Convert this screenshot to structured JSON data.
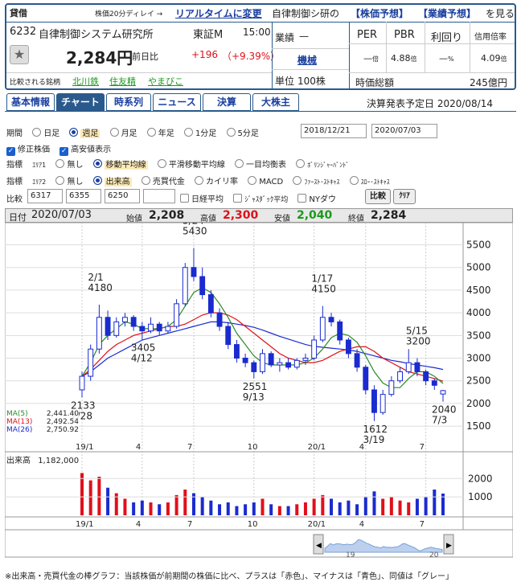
{
  "header": {
    "badge": "貸借",
    "delay_note": "株価20分ディレイ →",
    "realtime_link": "リアルタイムに変更",
    "promo_prefix": "自律制御シ研の",
    "forecast_link": "【株価予想】",
    "earnings_link": "【業績予想】",
    "promo_suffix": "を見る",
    "code": "6232",
    "name": "自律制御システム研究所",
    "market": "東証M",
    "time": "15:00",
    "price": "2,284円",
    "change_label": "前日比",
    "change": "+196",
    "change_pct": "（+9.39%）",
    "compare_label": "比較される銘柄",
    "compare_1": "北川鉄",
    "compare_2": "住友精",
    "compare_3": "やまびこ",
    "perf_label": "業績",
    "perf_value": "—",
    "sector": "機械",
    "unit_label": "単位",
    "unit_value": "100株",
    "per_label": "PER",
    "pbr_label": "PBR",
    "yield_label": "利回り",
    "margin_label": "信用倍率",
    "per_value": "—",
    "per_unit": "倍",
    "pbr_value": "4.88",
    "pbr_unit": "倍",
    "yield_value": "—",
    "yield_unit": "%",
    "margin_value": "4.09",
    "margin_unit": "倍",
    "cap_label": "時価総額",
    "cap_value": "245億円"
  },
  "tabs": [
    "基本情報",
    "チャート",
    "時系列",
    "ニュース",
    "決算",
    "大株主"
  ],
  "earnings_date": "決算発表予定日 2020/08/14",
  "controls": {
    "period_label": "期間",
    "periods": [
      "日足",
      "週足",
      "月足",
      "年足",
      "1分足",
      "5分足"
    ],
    "date_from": "2018/12/21",
    "date_to": "2020/07/03",
    "chk1": "修正株価",
    "chk2": "高安値表示",
    "ind1_label": "指標",
    "ind1_area": "ｴﾘｱ1",
    "ind1_opts": [
      "無し",
      "移動平均線",
      "平滑移動平均線",
      "一目均衡表",
      "ﾎﾞﾘﾝｼﾞｬｰﾊﾞﾝﾄﾞ"
    ],
    "ind2_label": "指標",
    "ind2_area": "ｴﾘｱ2",
    "ind2_opts": [
      "無し",
      "出来高",
      "売買代金",
      "カイリ率",
      "MACD",
      "ﾌｧｰｽﾄ･ｽﾄｷｬｽ",
      "ｽﾛｰ･ｽﾄｷｬｽ"
    ],
    "cmp_label": "比較",
    "cmp_codes": [
      "6317",
      "6355",
      "6250"
    ],
    "cmp_opts": [
      "日経平均",
      "ｼﾞｬｽﾀﾞｯｸ平均",
      "NYダウ"
    ],
    "cmp_btn": "比較",
    "clear_btn": "ｸﾘｱ"
  },
  "ohlc": {
    "date_label": "日付",
    "date": "2020/07/03",
    "open_label": "始値",
    "open": "2,208",
    "high_label": "高値",
    "high": "2,300",
    "low_label": "安値",
    "low": "2,040",
    "close_label": "終値",
    "close": "2,284"
  },
  "ma": {
    "ma5_label": "MA(5)",
    "ma5": "2,441.40",
    "ma13_label": "MA(13)",
    "ma13": "2,492.54",
    "ma26_label": "MA(26)",
    "ma26": "2,750.92"
  },
  "volume": {
    "label": "出来高",
    "value": "1,182,000"
  },
  "footnote": "※出来高・売買代金の棒グラフ：当該株価が前期間の株価に比べ、プラスは「赤色」、マイナスは「青色」、同値は「グレー」",
  "colors": {
    "up": "#e0101a",
    "down": "#1a2bd0",
    "ma5": "#2a8a2a",
    "ma13": "#e0101a",
    "ma26": "#1a2bd0",
    "frame": "#2a5a8c"
  },
  "chart_data": {
    "type": "candlestick",
    "x_tick_labels": [
      "19/1",
      "4",
      "7",
      "10",
      "20/1",
      "4",
      "7"
    ],
    "y_tick_labels": [
      5500,
      5000,
      4500,
      4000,
      3500,
      3000,
      2500,
      2000,
      1500
    ],
    "ylim": [
      1200,
      5900
    ],
    "annotations": [
      {
        "text": "5/24",
        "value": "5430"
      },
      {
        "text": "2/1",
        "value": "4180"
      },
      {
        "text": "1/17",
        "value": "4150"
      },
      {
        "text": "5/15",
        "value": "3200"
      },
      {
        "text": "3405",
        "value": "4/12"
      },
      {
        "text": "2551",
        "value": "9/13"
      },
      {
        "text": "2133",
        "value": "2/28"
      },
      {
        "text": "1612",
        "value": "3/19"
      },
      {
        "text": "2040",
        "value": "7/3"
      }
    ],
    "candles": [
      [
        2300,
        2700,
        2133,
        2600
      ],
      [
        2600,
        3300,
        2500,
        3200
      ],
      [
        3200,
        4180,
        3100,
        3900
      ],
      [
        3900,
        4050,
        3400,
        3500
      ],
      [
        3500,
        3900,
        3450,
        3800
      ],
      [
        3800,
        4000,
        3700,
        3900
      ],
      [
        3900,
        3950,
        3600,
        3700
      ],
      [
        3700,
        3800,
        3405,
        3600
      ],
      [
        3600,
        3900,
        3550,
        3750
      ],
      [
        3750,
        3800,
        3500,
        3600
      ],
      [
        3600,
        3800,
        3550,
        3700
      ],
      [
        3700,
        4300,
        3650,
        4200
      ],
      [
        4200,
        5100,
        4150,
        5000
      ],
      [
        5000,
        5430,
        4700,
        4800
      ],
      [
        4800,
        5000,
        4300,
        4400
      ],
      [
        4400,
        4500,
        3900,
        4000
      ],
      [
        4000,
        4100,
        3600,
        3700
      ],
      [
        3700,
        3800,
        3200,
        3300
      ],
      [
        3300,
        3400,
        2900,
        3000
      ],
      [
        3000,
        3100,
        2800,
        2900
      ],
      [
        2900,
        2950,
        2551,
        2700
      ],
      [
        2700,
        3200,
        2650,
        3100
      ],
      [
        3100,
        3150,
        2800,
        2850
      ],
      [
        2850,
        3000,
        2700,
        2900
      ],
      [
        2900,
        3000,
        2750,
        2800
      ],
      [
        2800,
        3000,
        2750,
        2950
      ],
      [
        2950,
        3100,
        2850,
        3000
      ],
      [
        3000,
        3500,
        2950,
        3400
      ],
      [
        3400,
        4150,
        3350,
        3900
      ],
      [
        3900,
        4000,
        3700,
        3800
      ],
      [
        3800,
        3850,
        3300,
        3400
      ],
      [
        3400,
        3450,
        3000,
        3100
      ],
      [
        3100,
        3200,
        2700,
        2800
      ],
      [
        2800,
        2850,
        2200,
        2300
      ],
      [
        2300,
        2400,
        1612,
        1800
      ],
      [
        1800,
        2300,
        1750,
        2200
      ],
      [
        2200,
        2600,
        2150,
        2500
      ],
      [
        2500,
        2800,
        2450,
        2700
      ],
      [
        2700,
        3200,
        2650,
        2900
      ],
      [
        2900,
        3000,
        2600,
        2700
      ],
      [
        2700,
        2750,
        2400,
        2500
      ],
      [
        2500,
        2550,
        2300,
        2400
      ],
      [
        2208,
        2300,
        2040,
        2284
      ]
    ],
    "ma5": [
      2600,
      2900,
      3300,
      3500,
      3650,
      3800,
      3750,
      3650,
      3650,
      3650,
      3700,
      3850,
      4150,
      4450,
      4550,
      4450,
      4200,
      3900,
      3550,
      3300,
      3050,
      2900,
      2850,
      2850,
      2850,
      2850,
      2900,
      3000,
      3200,
      3450,
      3550,
      3500,
      3350,
      3050,
      2700,
      2450,
      2350,
      2350,
      2550,
      2700,
      2700,
      2600,
      2441
    ],
    "ma13": [
      2600,
      2750,
      2950,
      3150,
      3300,
      3400,
      3500,
      3550,
      3600,
      3650,
      3700,
      3700,
      3750,
      3850,
      3950,
      4000,
      4000,
      3950,
      3850,
      3700,
      3550,
      3400,
      3250,
      3100,
      3000,
      2950,
      2900,
      2900,
      2950,
      3050,
      3150,
      3200,
      3250,
      3250,
      3150,
      3000,
      2900,
      2800,
      2700,
      2650,
      2600,
      2550,
      2492
    ],
    "ma26": [
      2600,
      2700,
      2850,
      3000,
      3100,
      3200,
      3300,
      3400,
      3450,
      3500,
      3550,
      3600,
      3650,
      3700,
      3750,
      3800,
      3800,
      3780,
      3750,
      3720,
      3680,
      3620,
      3550,
      3480,
      3420,
      3360,
      3300,
      3260,
      3240,
      3220,
      3200,
      3180,
      3150,
      3100,
      3050,
      3000,
      2950,
      2920,
      2880,
      2850,
      2820,
      2790,
      2751
    ],
    "volume_ylim": [
      0,
      2800
    ],
    "volume_ticks": [
      2000,
      1000
    ],
    "volume_values": [
      2300,
      1900,
      2100,
      1500,
      1200,
      900,
      700,
      800,
      700,
      600,
      700,
      1100,
      1400,
      1200,
      1000,
      800,
      600,
      700,
      500,
      600,
      700,
      900,
      600,
      500,
      500,
      600,
      700,
      900,
      1100,
      900,
      700,
      800,
      600,
      1000,
      1300,
      900,
      1000,
      800,
      700,
      900,
      1000,
      1400,
      1182
    ]
  }
}
